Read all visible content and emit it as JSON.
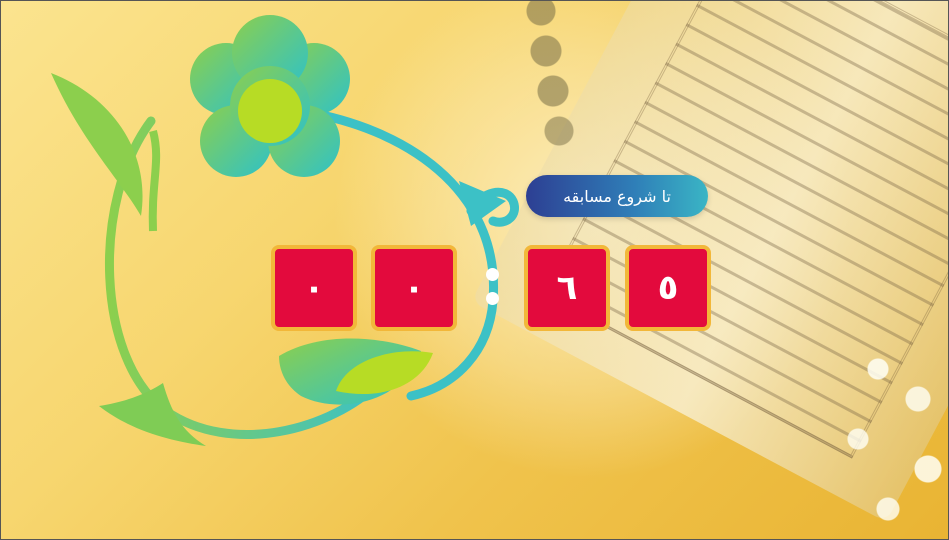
{
  "countdown": {
    "label": "تا شروع مسابقه",
    "digits": [
      "٥",
      "٦",
      "٠",
      "٠"
    ]
  },
  "colors": {
    "digit_bg": "#e30a3d",
    "digit_border": "#f2b739",
    "pill_start": "#2d3f93",
    "pill_end": "#3ab5c5",
    "ornament_teal": "#3cc1c6",
    "ornament_green": "#8ccf4d",
    "flower_center": "#b7dc25"
  }
}
